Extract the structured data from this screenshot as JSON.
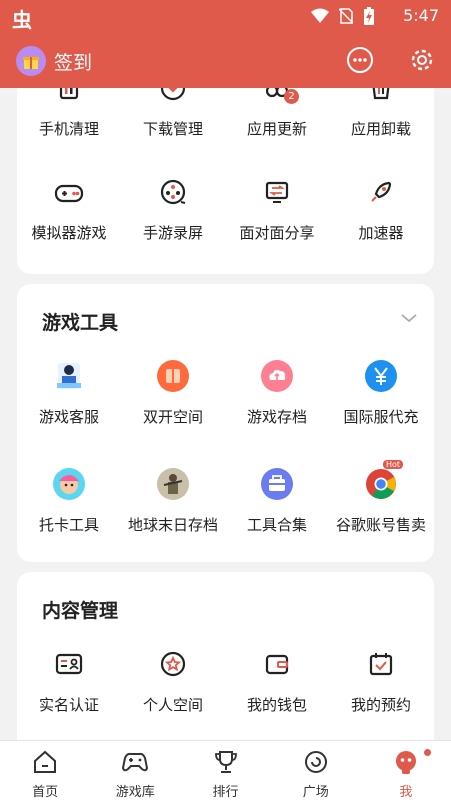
{
  "status_bar": {
    "app_glyph": "虫",
    "time": "5:47"
  },
  "header": {
    "title": "签到"
  },
  "section1": {
    "row1": [
      {
        "label": "手机清理",
        "icon": "cleanup-icon"
      },
      {
        "label": "下载管理",
        "icon": "download-icon"
      },
      {
        "label": "应用更新",
        "icon": "update-icon",
        "badge": "2"
      },
      {
        "label": "应用卸载",
        "icon": "uninstall-icon"
      }
    ],
    "row2": [
      {
        "label": "模拟器游戏",
        "icon": "gamepad-icon"
      },
      {
        "label": "手游录屏",
        "icon": "record-icon"
      },
      {
        "label": "面对面分享",
        "icon": "share-icon"
      },
      {
        "label": "加速器",
        "icon": "rocket-icon"
      }
    ]
  },
  "game_tools": {
    "title": "游戏工具",
    "row1": [
      {
        "label": "游戏客服",
        "icon": "customer-service-icon"
      },
      {
        "label": "双开空间",
        "icon": "dual-space-icon"
      },
      {
        "label": "游戏存档",
        "icon": "cloud-save-icon"
      },
      {
        "label": "国际服代充",
        "icon": "yuan-icon"
      }
    ],
    "row2": [
      {
        "label": "托卡工具",
        "icon": "toca-icon"
      },
      {
        "label": "地球末日存档",
        "icon": "soldier-icon"
      },
      {
        "label": "工具合集",
        "icon": "toolbox-icon"
      },
      {
        "label": "谷歌账号售卖",
        "icon": "chrome-icon",
        "badge": "Hot"
      }
    ]
  },
  "content_mgmt": {
    "title": "内容管理",
    "row1": [
      {
        "label": "实名认证",
        "icon": "id-card-icon"
      },
      {
        "label": "个人空间",
        "icon": "star-badge-icon"
      },
      {
        "label": "我的钱包",
        "icon": "wallet-icon"
      },
      {
        "label": "我的预约",
        "icon": "calendar-check-icon"
      }
    ]
  },
  "bottom_nav": [
    {
      "label": "首页",
      "icon": "home-icon"
    },
    {
      "label": "游戏库",
      "icon": "game-library-icon"
    },
    {
      "label": "排行",
      "icon": "trophy-icon"
    },
    {
      "label": "广场",
      "icon": "plaza-icon"
    },
    {
      "label": "我",
      "icon": "me-icon"
    }
  ],
  "colors": {
    "brand": "#e05a4b",
    "text": "#222222",
    "background": "#f2f2f2"
  }
}
